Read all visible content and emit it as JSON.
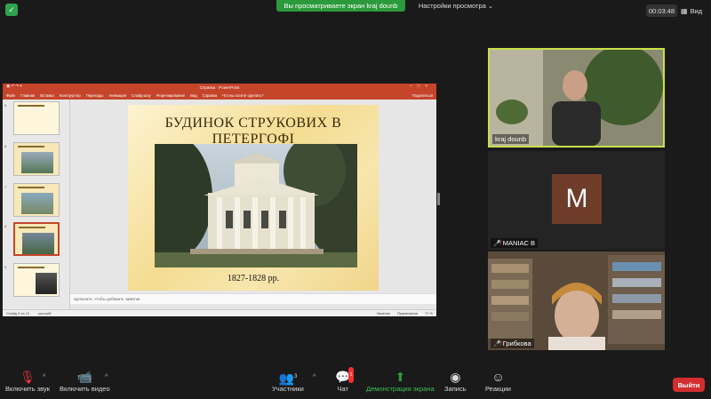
{
  "top_bar": {
    "share_banner": "Вы просматриваете экран kraj dounb",
    "view_settings": "Настройки просмотра",
    "view_settings_caret": "⌄",
    "timer": "00:03:48",
    "view_label": "Вид"
  },
  "ppt": {
    "window_title": "Справка · PowerPoint",
    "ribbon_tabs": [
      "Файл",
      "Главная",
      "Вставка",
      "Конструктор",
      "Переходы",
      "Анимация",
      "Слайд-шоу",
      "Рецензирование",
      "Вид",
      "Справка",
      "Что вы хотите сделать?"
    ],
    "share_label": "Поделиться",
    "thumbs": [
      {
        "num": "5"
      },
      {
        "num": "6"
      },
      {
        "num": "7"
      },
      {
        "num": "8"
      },
      {
        "num": "9"
      },
      {
        "num": "10"
      }
    ],
    "slide": {
      "title": "БУДИНОК СТРУКОВИХ В ПЕТЕРГОФІ",
      "caption": "1827-1828 рр."
    },
    "notes_placeholder": "Щелкните, чтобы добавить заметки",
    "status": {
      "slide_of": "Слайд 9 из 15",
      "language": "русский",
      "notes_btn": "Заметки",
      "comments_btn": "Примечания",
      "zoom": "72 %"
    }
  },
  "participants_tiles": [
    {
      "name": "kraj dounb",
      "muted": false
    },
    {
      "name": "MANIAC B",
      "muted": true,
      "initial": "M"
    },
    {
      "name": "Грибкова",
      "muted": true
    }
  ],
  "toolbar": {
    "unmute": "Включить звук",
    "start_video": "Включить видео",
    "participants": "Участники",
    "participants_count": "3",
    "chat": "Чат",
    "chat_badge": "1",
    "share_screen": "Демонстрация экрана",
    "record": "Запись",
    "reactions": "Реакции",
    "leave": "Выйти"
  },
  "colors": {
    "share_green": "#2b9a3c",
    "ppt_red": "#c4452a",
    "leave_red": "#d32f2f",
    "active_speaker": "#c8e04a"
  }
}
